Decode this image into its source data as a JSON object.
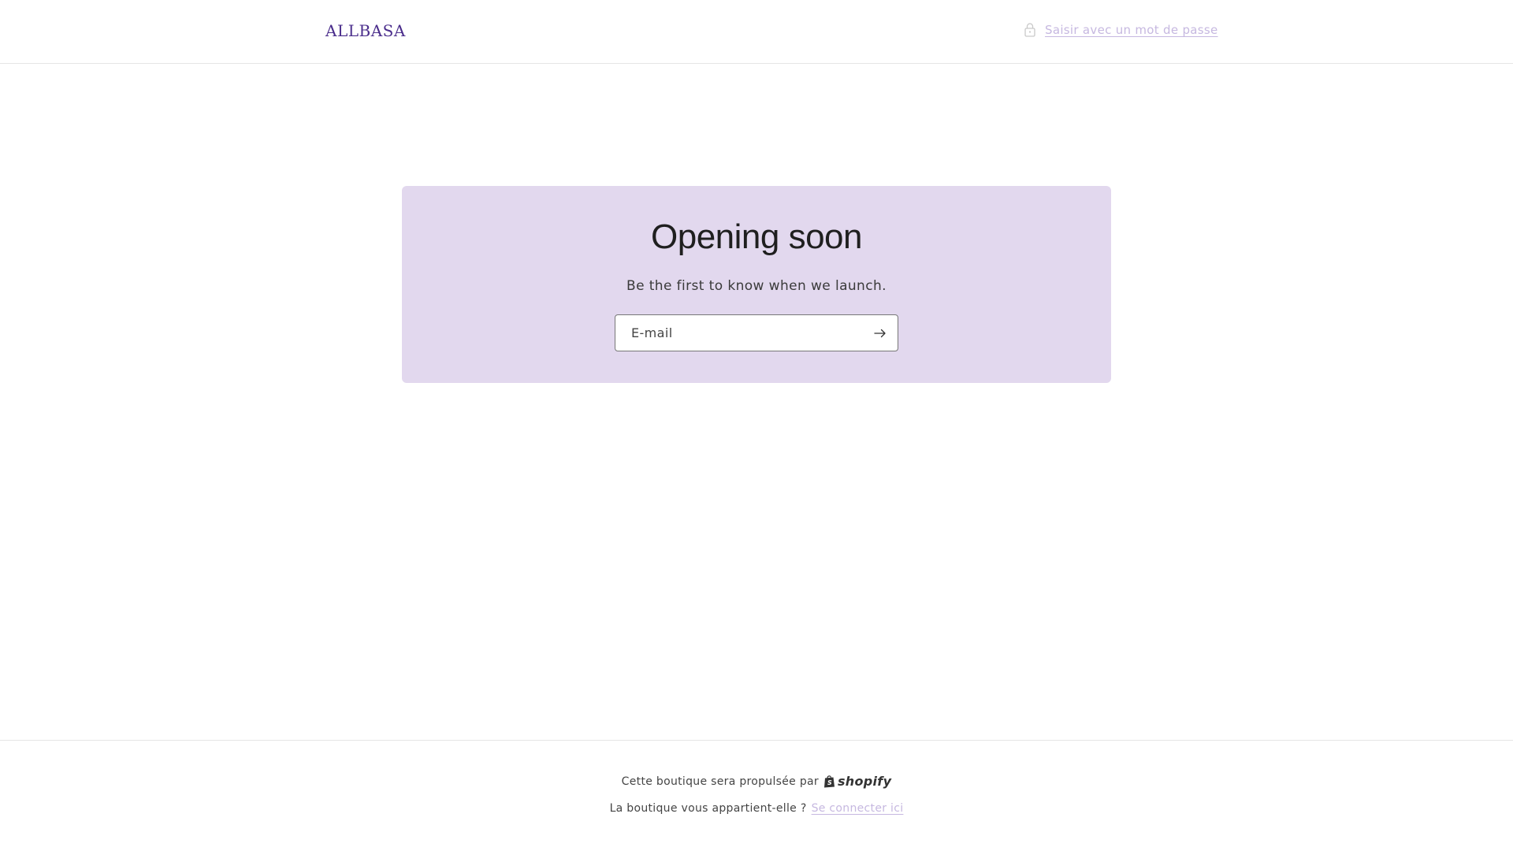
{
  "header": {
    "logo_text": "ALLBASA",
    "password_link_label": "Saisir avec un mot de passe",
    "lock_icon": "lock-icon"
  },
  "newsletter": {
    "title": "Opening soon",
    "subtitle": "Be the first to know when we launch.",
    "email_placeholder": "E-mail",
    "email_value": "",
    "submit_icon": "arrow-right-icon"
  },
  "footer": {
    "powered_text": "Cette boutique sera propulsée par",
    "shopify_logo_text": "shopify",
    "owner_question": "La boutique vous appartient-elle ?",
    "login_link_label": "Se connecter ici"
  },
  "colors": {
    "brand": "#4b2e8c",
    "card_background": "#e2d8ee",
    "link": "#c6b8e0"
  }
}
